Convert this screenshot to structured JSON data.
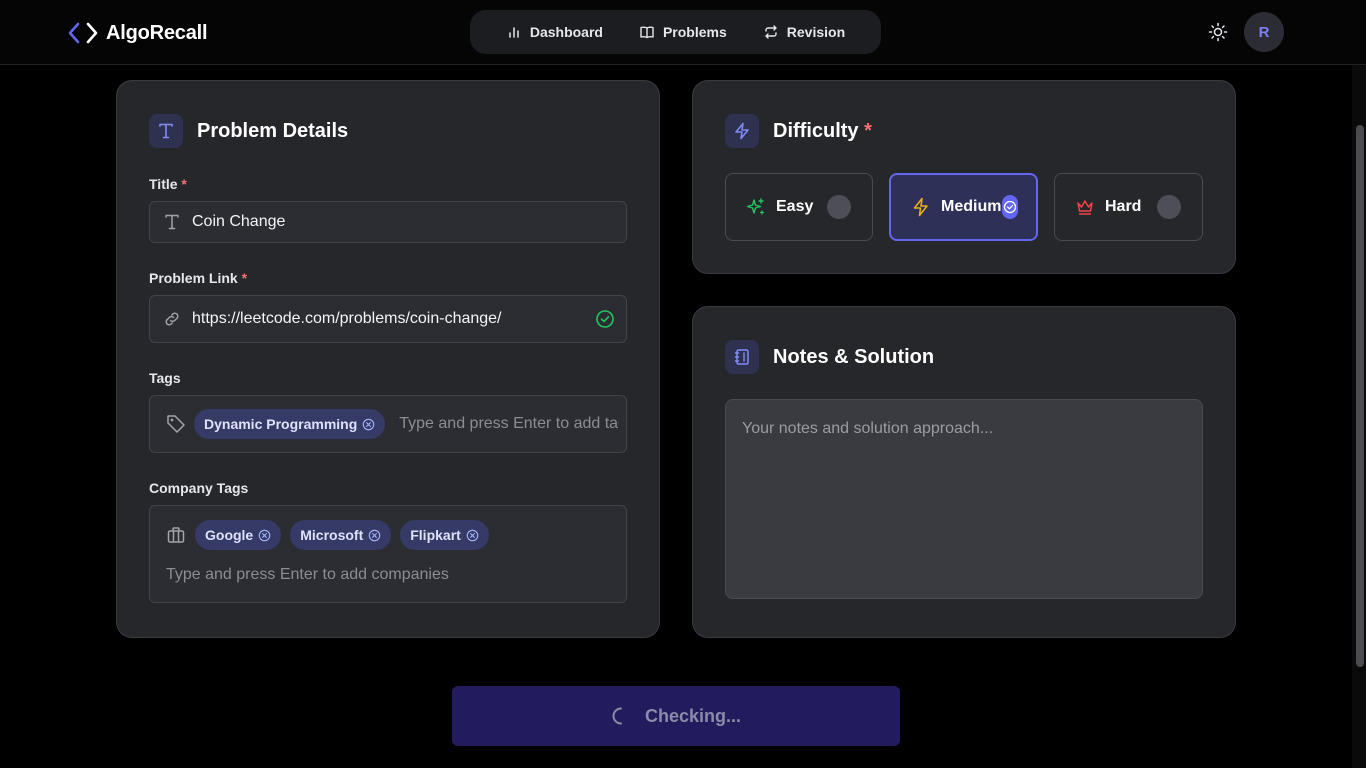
{
  "app": {
    "name": "AlgoRecall"
  },
  "nav": {
    "items": [
      {
        "label": "Dashboard",
        "icon": "bar-chart-icon"
      },
      {
        "label": "Problems",
        "icon": "book-open-icon"
      },
      {
        "label": "Revision",
        "icon": "repeat-icon"
      }
    ]
  },
  "user": {
    "initial": "R"
  },
  "problem_details": {
    "heading": "Problem Details",
    "title_label": "Title",
    "title_value": "Coin Change",
    "link_label": "Problem Link",
    "link_value": "https://leetcode.com/problems/coin-change/",
    "tags_label": "Tags",
    "tags": [
      "Dynamic Programming"
    ],
    "tags_placeholder": "Type and press Enter to add tags",
    "company_label": "Company Tags",
    "companies": [
      "Google",
      "Microsoft",
      "Flipkart"
    ],
    "company_placeholder": "Type and press Enter to add companies"
  },
  "difficulty": {
    "heading": "Difficulty",
    "required_mark": "*",
    "options": [
      {
        "label": "Easy",
        "color": "#22c55e"
      },
      {
        "label": "Medium",
        "color": "#eab308"
      },
      {
        "label": "Hard",
        "color": "#ef4444"
      }
    ],
    "selected": "Medium"
  },
  "notes": {
    "heading": "Notes & Solution",
    "placeholder": "Your notes and solution approach..."
  },
  "submit": {
    "label": "Checking..."
  },
  "colors": {
    "accent": "#6366f1",
    "card_bg": "#26272b",
    "page_bg": "#000000"
  }
}
